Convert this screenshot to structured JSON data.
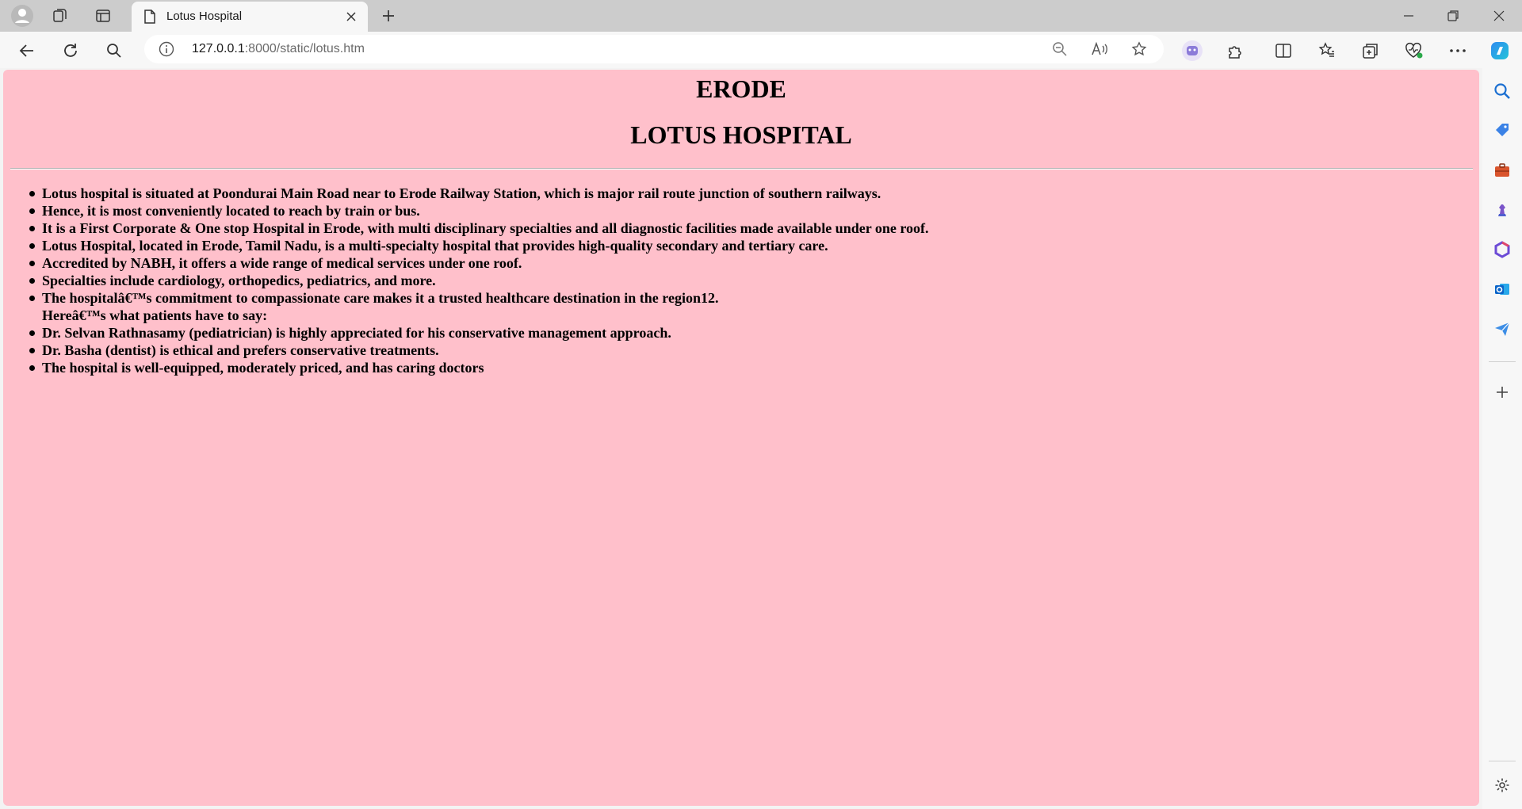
{
  "browser": {
    "tab": {
      "title": "Lotus Hospital"
    },
    "address": {
      "host": "127.0.0.1",
      "path": ":8000/static/lotus.htm"
    },
    "icons": {
      "profile": "profile-icon",
      "workspaces": "workspaces-icon",
      "tab_actions": "tab-actions-icon",
      "new_tab": "plus-icon",
      "back": "back-arrow-icon",
      "refresh": "refresh-icon",
      "search": "search-icon",
      "zoom": "zoom-out-icon",
      "read_aloud": "read-aloud-icon",
      "favorite": "star-icon",
      "extensions": "puzzle-icon",
      "split": "split-screen-icon",
      "favorites": "favorites-icon",
      "collections": "collections-icon",
      "health": "browser-essentials-icon",
      "more": "more-icon",
      "copilot": "copilot-icon"
    }
  },
  "page": {
    "heading_city": "ERODE",
    "heading_hospital": "LOTUS HOSPITAL",
    "items": [
      "Lotus hospital is situated at Poondurai Main Road near to Erode Railway Station, which is major rail route junction of southern railways.",
      "Hence, it is most conveniently located to reach by train or bus.",
      "It is a First Corporate & One stop Hospital in Erode, with multi disciplinary specialties and all diagnostic facilities made available under one roof.",
      "Lotus Hospital, located in Erode, Tamil Nadu, is a multi-specialty hospital that provides high-quality secondary and tertiary care.",
      "Accredited by NABH, it offers a wide range of medical services under one roof.",
      "Specialties include cardiology, orthopedics, pediatrics, and more.",
      "The hospitalâ€™s commitment to compassionate care makes it a trusted healthcare destination in the region12.",
      "Hereâ€™s what patients have to say:",
      "Dr. Selvan Rathnasamy (pediatrician) is highly appreciated for his conservative management approach.",
      "Dr. Basha (dentist) is ethical and prefers conservative treatments.",
      "The hospital is well-equipped, moderately priced, and has caring doctors"
    ],
    "bulleted": [
      true,
      true,
      true,
      true,
      true,
      true,
      true,
      false,
      true,
      true,
      true
    ],
    "background": "#ffc0cb"
  }
}
